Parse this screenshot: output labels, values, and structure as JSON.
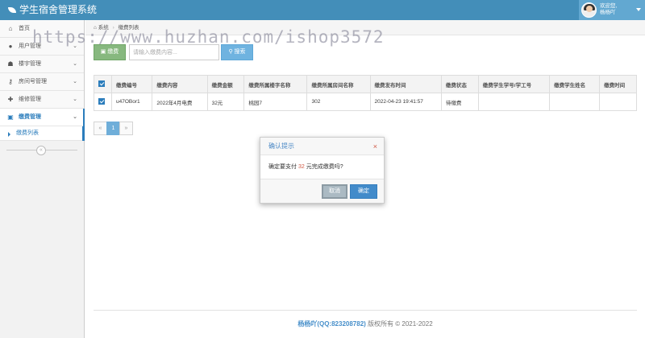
{
  "header": {
    "app_title": "学生宿舍管理系统",
    "welcome": "欢迎您,",
    "username": "杨杨吖"
  },
  "sidebar": {
    "items": [
      {
        "label": "首页",
        "icon": "home-icon"
      },
      {
        "label": "用户管理",
        "icon": "user-icon"
      },
      {
        "label": "楼宇管理",
        "icon": "building-icon"
      },
      {
        "label": "房间号管理",
        "icon": "key-icon"
      },
      {
        "label": "维修管理",
        "icon": "wrench-icon"
      },
      {
        "label": "缴费管理",
        "icon": "money-icon"
      }
    ],
    "sub_items": [
      {
        "label": "缴费列表"
      }
    ]
  },
  "breadcrumb": {
    "root": "系统",
    "current": "缴费列表"
  },
  "toolbar": {
    "pay_label": "缴费",
    "search_placeholder": "请输入缴费内容...",
    "search_label": "搜索"
  },
  "table": {
    "headers": [
      "缴费编号",
      "缴费内容",
      "缴费金额",
      "缴费所属楼字名称",
      "缴费所属房间名称",
      "缴费发布时间",
      "缴费状态",
      "缴费学生学号/学工号",
      "缴费学生姓名",
      "缴费时间"
    ],
    "rows": [
      [
        "u47OBor1",
        "2022年4月电费",
        "32元",
        "桃园7",
        "302",
        "2022-04-23 19:41:57",
        "待缴费",
        "",
        "",
        ""
      ]
    ]
  },
  "pager": {
    "prev": "«",
    "current": "1",
    "next": "»"
  },
  "modal": {
    "title": "确认提示",
    "close": "×",
    "message_prefix": "确定要支付",
    "amount": "32",
    "message_suffix": "元完成缴费吗?",
    "cancel_label": "取消",
    "ok_label": "确定"
  },
  "footer": {
    "author": "杨杨吖(QQ:823208782)",
    "copyright": "版权所有 © 2021-2022"
  },
  "watermark": "https://www.huzhan.com/ishop3572",
  "colors": {
    "header_bg": "#438eb9",
    "accent": "#2b7dbc",
    "pay_button": "#87b87f",
    "search_button": "#6fb3e0",
    "amount_highlight": "#d15b47"
  }
}
